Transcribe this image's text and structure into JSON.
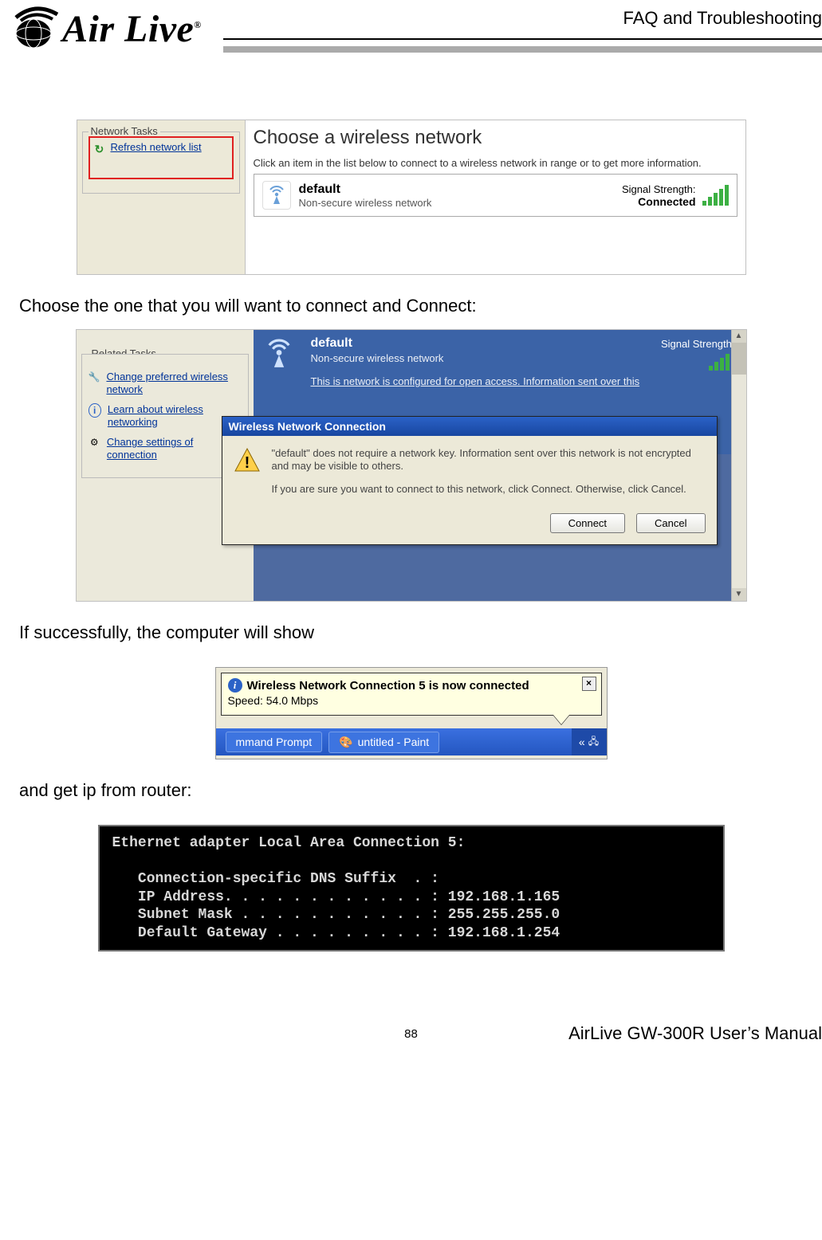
{
  "header": {
    "section_title": "FAQ and Troubleshooting",
    "logo_text": "Air Live",
    "logo_reg": "®"
  },
  "body": {
    "p1": "Choose the one that you will want to connect and Connect:",
    "p2": "If successfully, the computer will show",
    "p3": "and get ip from router:"
  },
  "shot1": {
    "tasks_label": "Network Tasks",
    "refresh_link": "Refresh network list",
    "title": "Choose a wireless network",
    "instr": "Click an item in the list below to connect to a wireless network in range or to get more information.",
    "net_name": "default",
    "net_sub": "Non-secure wireless network",
    "sig_label": "Signal Strength:",
    "status": "Connected"
  },
  "shot2": {
    "related_label": "Related Tasks",
    "rel1": "Change preferred wireless network",
    "rel2": "Learn about wireless networking",
    "rel3": "Change settings of connection",
    "net_name": "default",
    "net_sub": "Non-secure wireless network",
    "net_config": "This is network is configured for open access. Information sent over this",
    "sig_label": "Signal Strength:",
    "dlg_title": "Wireless Network Connection",
    "dlg_p1": "\"default\" does not require a network key. Information sent over this network is not encrypted and may be visible to others.",
    "dlg_p2": "If you are sure you want to connect to this network, click Connect. Otherwise, click Cancel.",
    "btn_connect": "Connect",
    "btn_cancel": "Cancel"
  },
  "shot3": {
    "balloon_title": "Wireless Network Connection 5 is now connected",
    "balloon_sub": "Speed: 54.0 Mbps",
    "task_cmd": "mmand Prompt",
    "task_paint": "untitled - Paint",
    "tray_chev": "«"
  },
  "shot4": {
    "l1": "Ethernet adapter Local Area Connection 5:",
    "l2": "   Connection-specific DNS Suffix  . :",
    "l3": "   IP Address. . . . . . . . . . . . : 192.168.1.165",
    "l4": "   Subnet Mask . . . . . . . . . . . : 255.255.255.0",
    "l5": "   Default Gateway . . . . . . . . . : 192.168.1.254"
  },
  "footer": {
    "page": "88",
    "manual": "AirLive GW-300R User’s Manual"
  }
}
